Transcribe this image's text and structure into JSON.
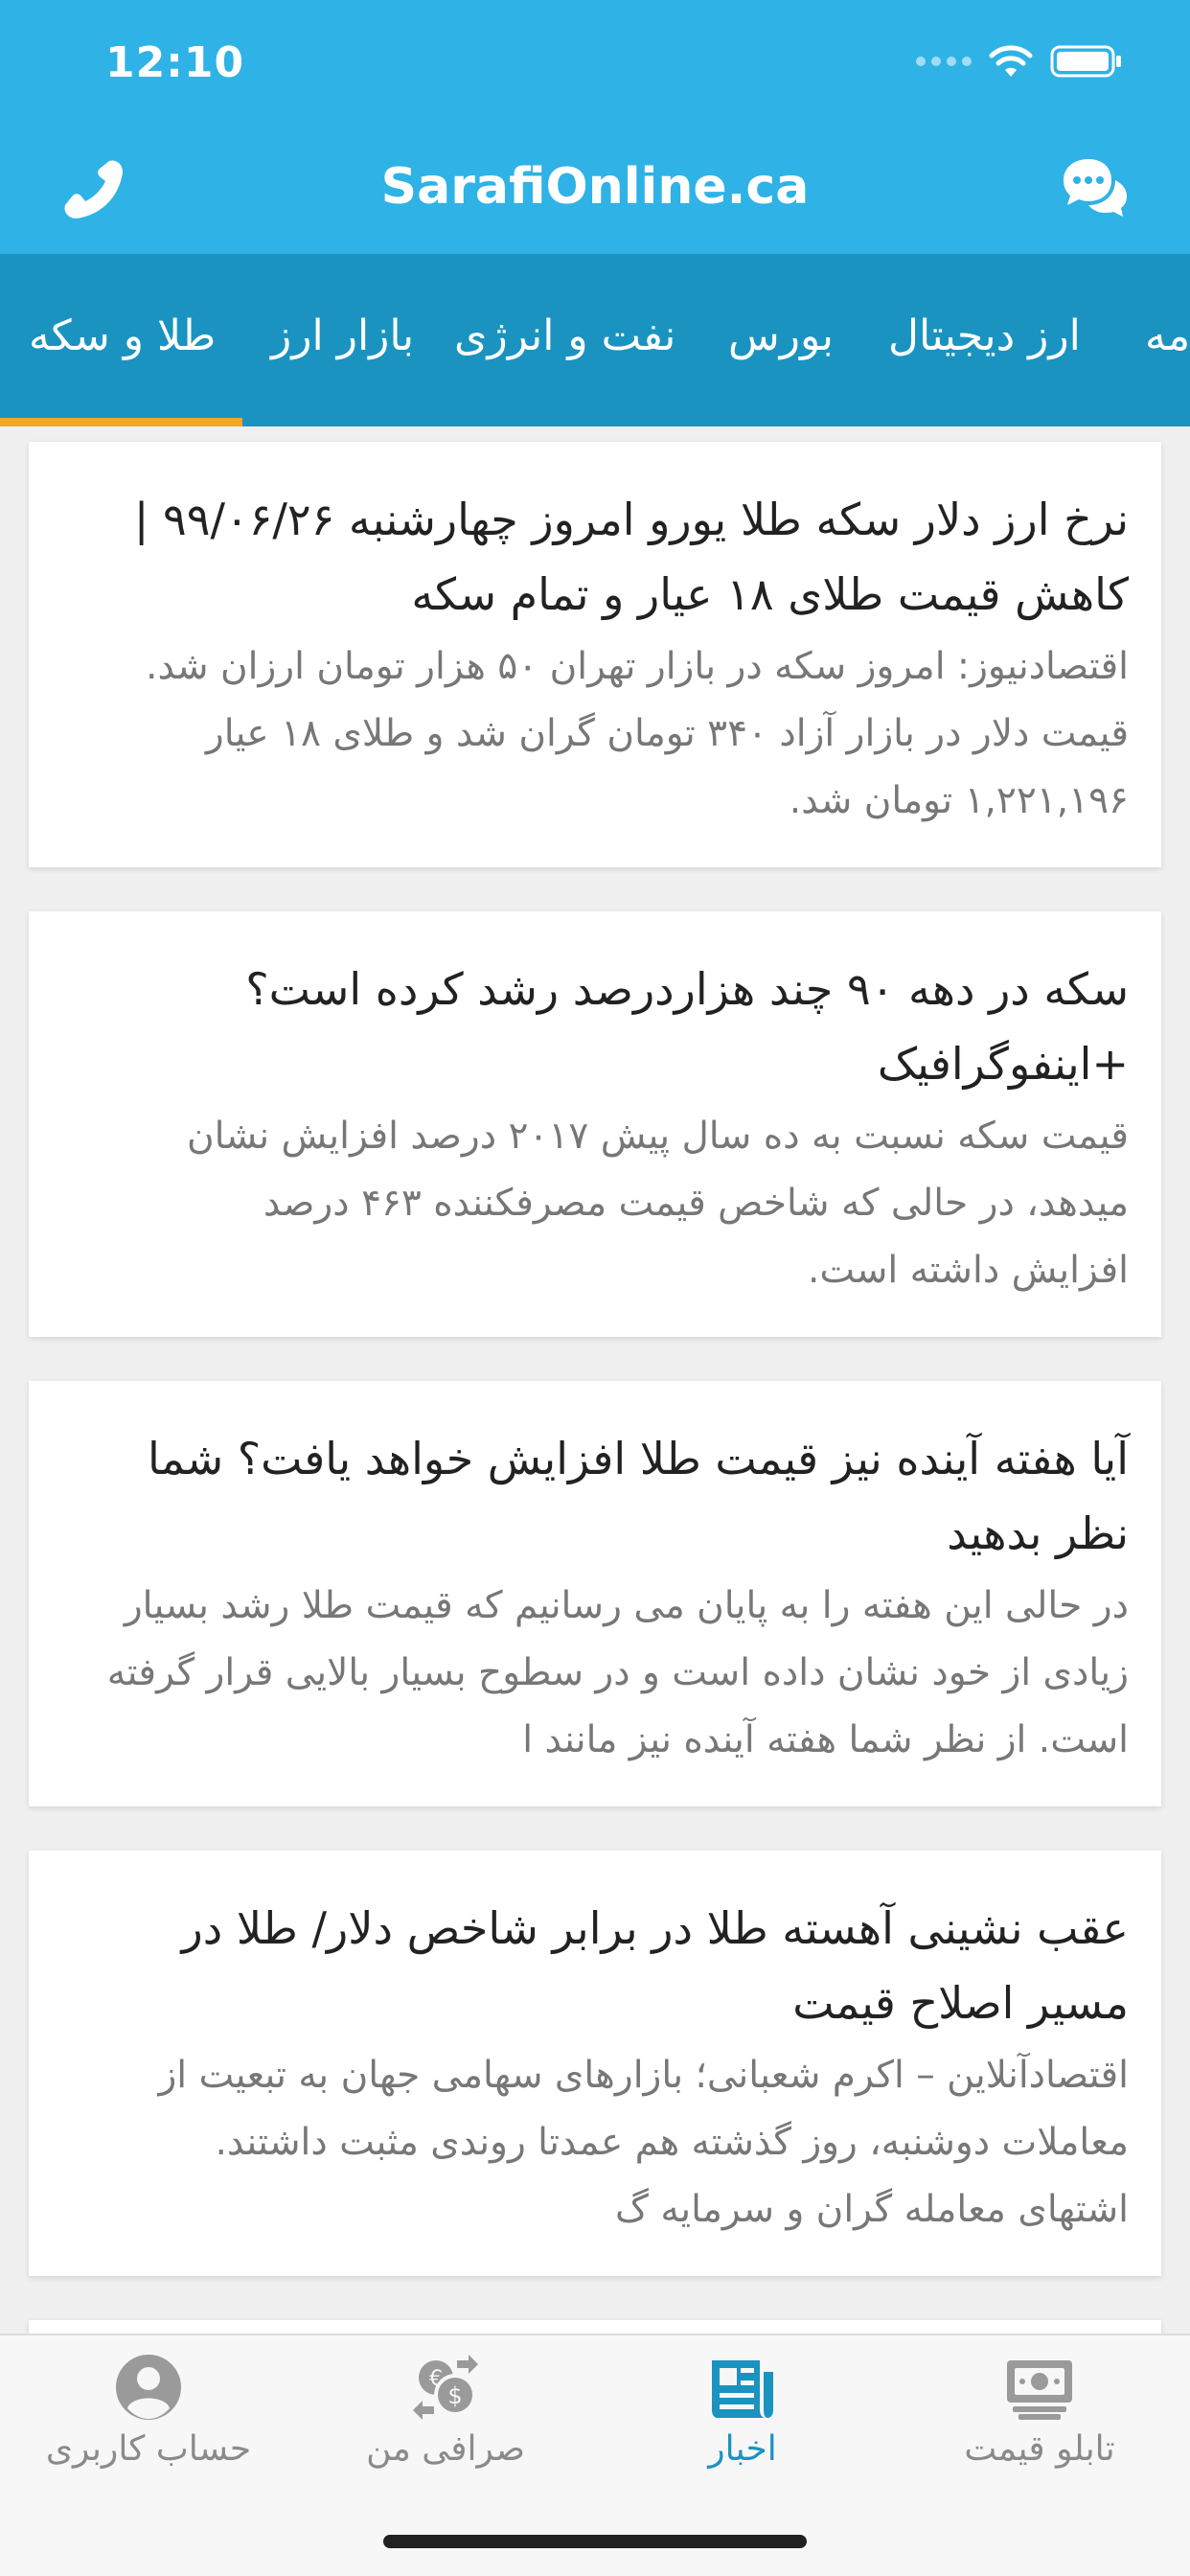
{
  "status_bar": {
    "time": "12:10"
  },
  "header": {
    "title": "SarafiOnline.ca"
  },
  "tabs": [
    {
      "label": "طلا و سکه",
      "active": true
    },
    {
      "label": "بازار ارز"
    },
    {
      "label": "نفت و انرژی"
    },
    {
      "label": "بورس"
    },
    {
      "label": "ارز دیجیتال"
    },
    {
      "label": "مه"
    }
  ],
  "articles": [
    {
      "title_lines": [
        "نرخ ارز دلار سکه طلا یورو امروز چهارشنبه ۹۹/۰۶/۲۶ |",
        "کاهش قیمت طلای ۱۸ عیار و تمام سکه"
      ],
      "summary_lines": [
        "اقتصادنیوز: امروز سکه در بازار تهران ۵۰ هزار تومان ارزان شد.",
        "قیمت دلار در بازار آزاد ۳۴۰ تومان گران شد و طلای ۱۸ عیار",
        "۱,۲۲۱,۱۹۶ تومان شد."
      ]
    },
    {
      "title_lines": [
        "سکه در دهه ۹۰ چند هزاردرصد رشد کرده است؟",
        "+اینفوگرافیک"
      ],
      "summary_lines": [
        "قیمت سکه نسبت به ده سال پیش ۲۰۱۷ درصد افزایش نشان",
        "میدهد، در حالی که شاخص قیمت مصرفکننده ۴۶۳ درصد",
        "افزایش داشته است."
      ]
    },
    {
      "title_lines": [
        "آیا هفته آینده نیز قیمت طلا افزایش خواهد یافت؟ شما",
        "نظر بدهید"
      ],
      "summary_lines": [
        "در حالی این هفته را به پایان می رسانیم که قیمت طلا رشد بسیار",
        "زیادی از خود نشان داده است و در سطوح بسیار بالایی قرار گرفته",
        "است. از نظر شما هفته آینده نیز مانند ا"
      ]
    },
    {
      "title_lines": [
        "عقب نشینی آهسته طلا در برابر شاخص دلار/ طلا در",
        "مسیر اصلاح قیمت"
      ],
      "summary_lines": [
        "اقتصادآنلاین – اکرم شعبانی؛ بازارهای سهامی جهان به تبعیت از",
        "معاملات دوشنبه، روز گذشته هم عمدتا روندی مثبت داشتند.",
        "اشتهای معامله گران و سرمایه گ"
      ]
    }
  ],
  "bottom_nav": [
    {
      "label": "حساب کاربری",
      "icon": "user-icon"
    },
    {
      "label": "صرافی من",
      "icon": "currency-exchange-icon"
    },
    {
      "label": "اخبار",
      "icon": "news-icon",
      "active": true
    },
    {
      "label": "تابلو قیمت",
      "icon": "price-board-icon"
    }
  ],
  "colors": {
    "header": "#2fb2e6",
    "tabs": "#1a93c0",
    "tab_indicator": "#f5a623",
    "active_nav": "#1a93c0",
    "inactive_nav": "#8a8a8a"
  }
}
